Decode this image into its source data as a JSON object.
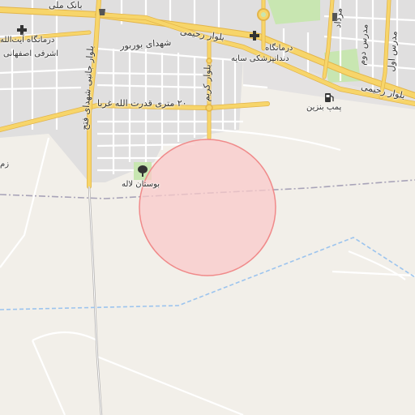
{
  "map": {
    "colors": {
      "background": "#f2efe9",
      "urban": "#e0dfdf",
      "park": "#c8e6b1",
      "main_road": "#f7d56a",
      "road_casing": "#e3b54a",
      "minor_road": "#ffffff",
      "boundary": "#a8a3b8",
      "waterway": "#9cc4ee",
      "highlight_fill": "#f9c9c9",
      "highlight_stroke": "#f08a8a"
    },
    "labels": {
      "bank_melli": "بانک ملی",
      "clinic_ayatollah": "درمانگاه آیت‌الله",
      "ashrafi_esfahani": "اشرفی اصفهانی",
      "shohada_boorboor": "شهدای بوربور",
      "blvd_rahimi_1": "بلوار رحیمی",
      "clinic_dental": "درمانگاه",
      "dental_saye": "دندانپزشکی سایه",
      "blvd_rahimi_2": "بلوار رحیمی",
      "street_qodrat": "۲۰ متری قدرت الله غربا",
      "gas_station": "پمپ بنزین",
      "park_laleh": "بوستان لاله",
      "zam": "زم",
      "blvd_shohada_fath": "بلوار جانبی شهدای فتح",
      "street_v2": "بلوار کریم",
      "street_madares_1": "مرداد",
      "street_madares_2": "مدرس دوم",
      "street_madares_3": "مدرس اول"
    },
    "icons": [
      "clinic-cross-icon",
      "fuel-pump-icon",
      "park-tree-icon",
      "roundabout-icon",
      "poi-dot-icon"
    ]
  }
}
